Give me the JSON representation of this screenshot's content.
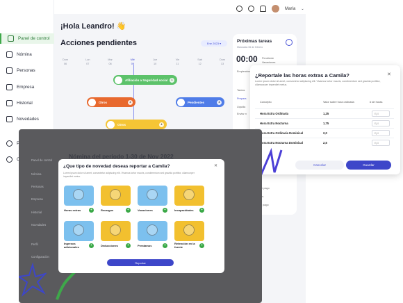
{
  "app": {
    "user_name": "María",
    "greeting": "¡Hola Leandro! 👋",
    "pending_title": "Acciones pendientes",
    "date_pill": "Ene 2023 ▾"
  },
  "sidebar": {
    "items": [
      {
        "label": "Panel de control",
        "icon": "dashboard-icon"
      },
      {
        "label": "Nómina",
        "icon": "payroll-icon"
      },
      {
        "label": "Personas",
        "icon": "people-icon"
      },
      {
        "label": "Empresa",
        "icon": "briefcase-icon"
      },
      {
        "label": "Historial",
        "icon": "history-icon"
      },
      {
        "label": "Novedades",
        "icon": "news-icon"
      },
      {
        "label": "P",
        "icon": "profile-icon"
      },
      {
        "label": "C",
        "icon": "settings-icon"
      }
    ]
  },
  "timeline": {
    "days": [
      {
        "d": "Dom",
        "n": "06"
      },
      {
        "d": "Lun",
        "n": "07"
      },
      {
        "d": "Mar",
        "n": "08"
      },
      {
        "d": "Mié",
        "n": "09"
      },
      {
        "d": "Jue",
        "n": "10"
      },
      {
        "d": "Vie",
        "n": "11"
      },
      {
        "d": "Sab",
        "n": "12"
      },
      {
        "d": "Dom",
        "n": "13"
      }
    ],
    "pills": [
      {
        "label": "Afiliación a Seguridad social",
        "color": "#5cc26a",
        "badge": "1"
      },
      {
        "label": "Otros",
        "color": "#e8692e",
        "badge": "2"
      },
      {
        "label": "Pendientes",
        "color": "#4f7ce8",
        "badge": "3"
      },
      {
        "label": "Otros",
        "color": "#f5c535",
        "badge": "4"
      }
    ]
  },
  "tasks": {
    "title": "Próximas tareas",
    "subtitle": "Marcadas 06 de febrero",
    "clock": "00:00",
    "side_labels": [
      "Empleados",
      "Tareas",
      "Prepara",
      "Liquida",
      "Enviar n",
      "Pendiente",
      "Vacaciones"
    ],
    "list": [
      "s de pago",
      "ones",
      "ose pago"
    ]
  },
  "horas": {
    "title": "¿Reportale las horas extras a Camila?",
    "description": "Lorem ipsum dolor sit amet, consectetur adipiscing elit. Vivamus tortor mauris, condimentum sed gravida porttitor, ullamcorper imperdiet metus.",
    "col_concept": "Concepto",
    "col_value": "Valor sobre hora ordinaria",
    "col_hours": "# de horas",
    "rows": [
      {
        "name": "Hora Extra Ordinaria",
        "value": "1,25",
        "placeholder": "Ej.0"
      },
      {
        "name": "Hora Extra Nocturna",
        "value": "1,75",
        "placeholder": "Ej.0"
      },
      {
        "name": "Hora Extra Ordinaria Dominical",
        "value": "2,0",
        "placeholder": "Ej.0"
      },
      {
        "name": "Hora Extra Nocturna Dominical",
        "value": "2,5",
        "placeholder": "Ej.0"
      }
    ],
    "cancel": "Cancelar",
    "save": "Guardar"
  },
  "overlay": {
    "bg_title": "Nómina del periodo 1-30 de Nov 2022",
    "bg_sidebar": [
      "Panel de control",
      "Nómina",
      "Personas",
      "Empresa",
      "Historial",
      "Novedades",
      "Perfil",
      "Configuración"
    ],
    "modal_title": "¿Que tipo de novedad deseas reportar a Camila?",
    "modal_desc": "Lorem ipsum dolor sit amet, consectetur adipiscing elit. Vivamus tortor mauris, condimentum sed gravida porttitor, ullamcorper imperdiet metus.",
    "cards": [
      {
        "label": "Horas extras",
        "color": "#7cc0ee"
      },
      {
        "label": "Recargos",
        "color": "#f2c02f"
      },
      {
        "label": "Vacaciones",
        "color": "#7cc0ee"
      },
      {
        "label": "Incapacidades",
        "color": "#f2c02f"
      },
      {
        "label": "Ingresos adicionales",
        "color": "#7cc0ee"
      },
      {
        "label": "Deducciones",
        "color": "#f2c02f"
      },
      {
        "label": "Prestamos",
        "color": "#7cc0ee"
      },
      {
        "label": "Retención en la fuente",
        "color": "#f2c02f"
      }
    ],
    "report_button": "Reportar"
  }
}
